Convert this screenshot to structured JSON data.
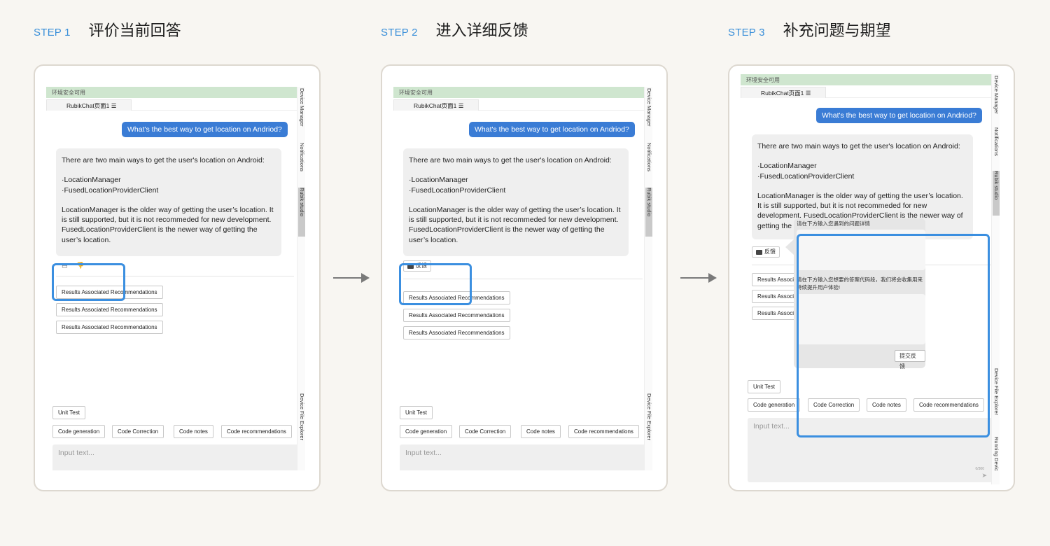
{
  "steps": [
    {
      "num": "STEP 1",
      "title": "评价当前回答"
    },
    {
      "num": "STEP 2",
      "title": "进入详细反馈"
    },
    {
      "num": "STEP 3",
      "title": "补充问题与期望"
    }
  ],
  "app": {
    "env_status": "环境安全可用",
    "tab_label": "RubikChat页面1",
    "tab_menu_icon": "☰",
    "sidebar": {
      "device_manager": "Device Manager",
      "notifications": "Notifications",
      "rubik_studio": "Rubik studio",
      "device_file_explorer": "Device File Explorer",
      "running_devices": "Running Devic"
    },
    "user_question": "What's the best way to get location on Andriod?",
    "answer": {
      "intro": "There are two main ways to get the user's location on Android:",
      "item1": "·LocationManager",
      "item2": "·FusedLocationProviderClient",
      "detail": "LocationManager is the older way of getting the user’s location. It is still supported, but it is not recommeded for new development. FusedLocationProviderClient is the newer way of getting the user’s location.",
      "detail_truncated": "LocationManager is the older way of getting the user’s location. It is still supported, but it is not recommeded for new development. FusedLocationProviderClient is the newer way of getting the"
    },
    "feedback_label": "反馈",
    "recommendation_chip": "Results Associated Recommendations",
    "recommendation_chip_short": "Results Associ",
    "actions": {
      "unit_test": "Unit Test",
      "code_generation": "Code generation",
      "code_correction": "Code Correction",
      "code_notes": "Code notes",
      "code_recommendations": "Code recommendations"
    },
    "input_placeholder": "Input text...",
    "char_count": "0/300"
  },
  "feedback_popup": {
    "problem_label": "请在下方输入您遇到的问题详情",
    "expected_label": "请在下方输入您想要的答案代码段，我们将会收集用来持续提升用户体验!",
    "submit_label": "提交反馈"
  },
  "colors": {
    "accent": "#3a8fd9",
    "user_bubble": "#3a7cd5",
    "highlight": "#3b8fe0",
    "env_bar": "#cfe6cf"
  }
}
